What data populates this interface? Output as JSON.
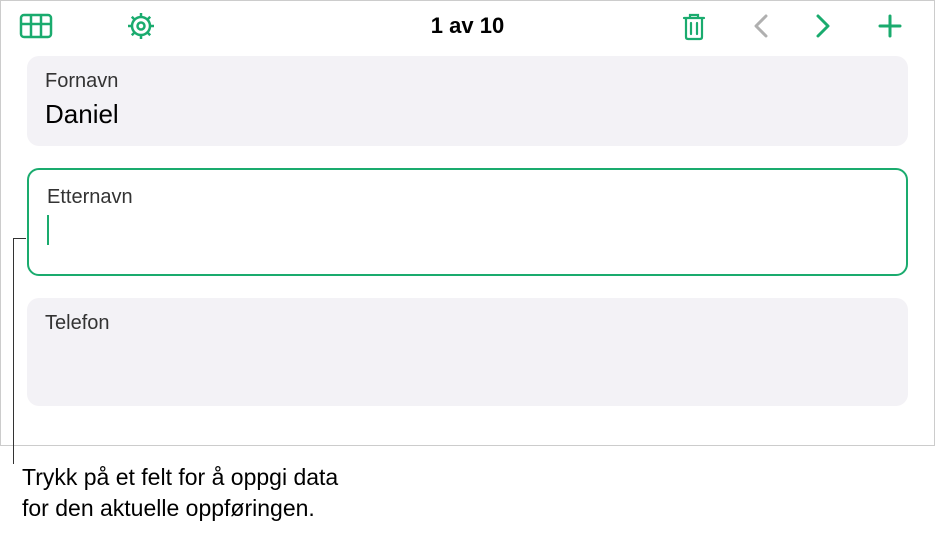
{
  "toolbar": {
    "counter": "1 av 10"
  },
  "fields": {
    "first_name": {
      "label": "Fornavn",
      "value": "Daniel"
    },
    "last_name": {
      "label": "Etternavn",
      "value": ""
    },
    "phone": {
      "label": "Telefon",
      "value": ""
    }
  },
  "callout": {
    "line1": "Trykk på et felt for å oppgi data",
    "line2": "for den aktuelle oppføringen."
  },
  "colors": {
    "accent": "#1aab6e"
  }
}
